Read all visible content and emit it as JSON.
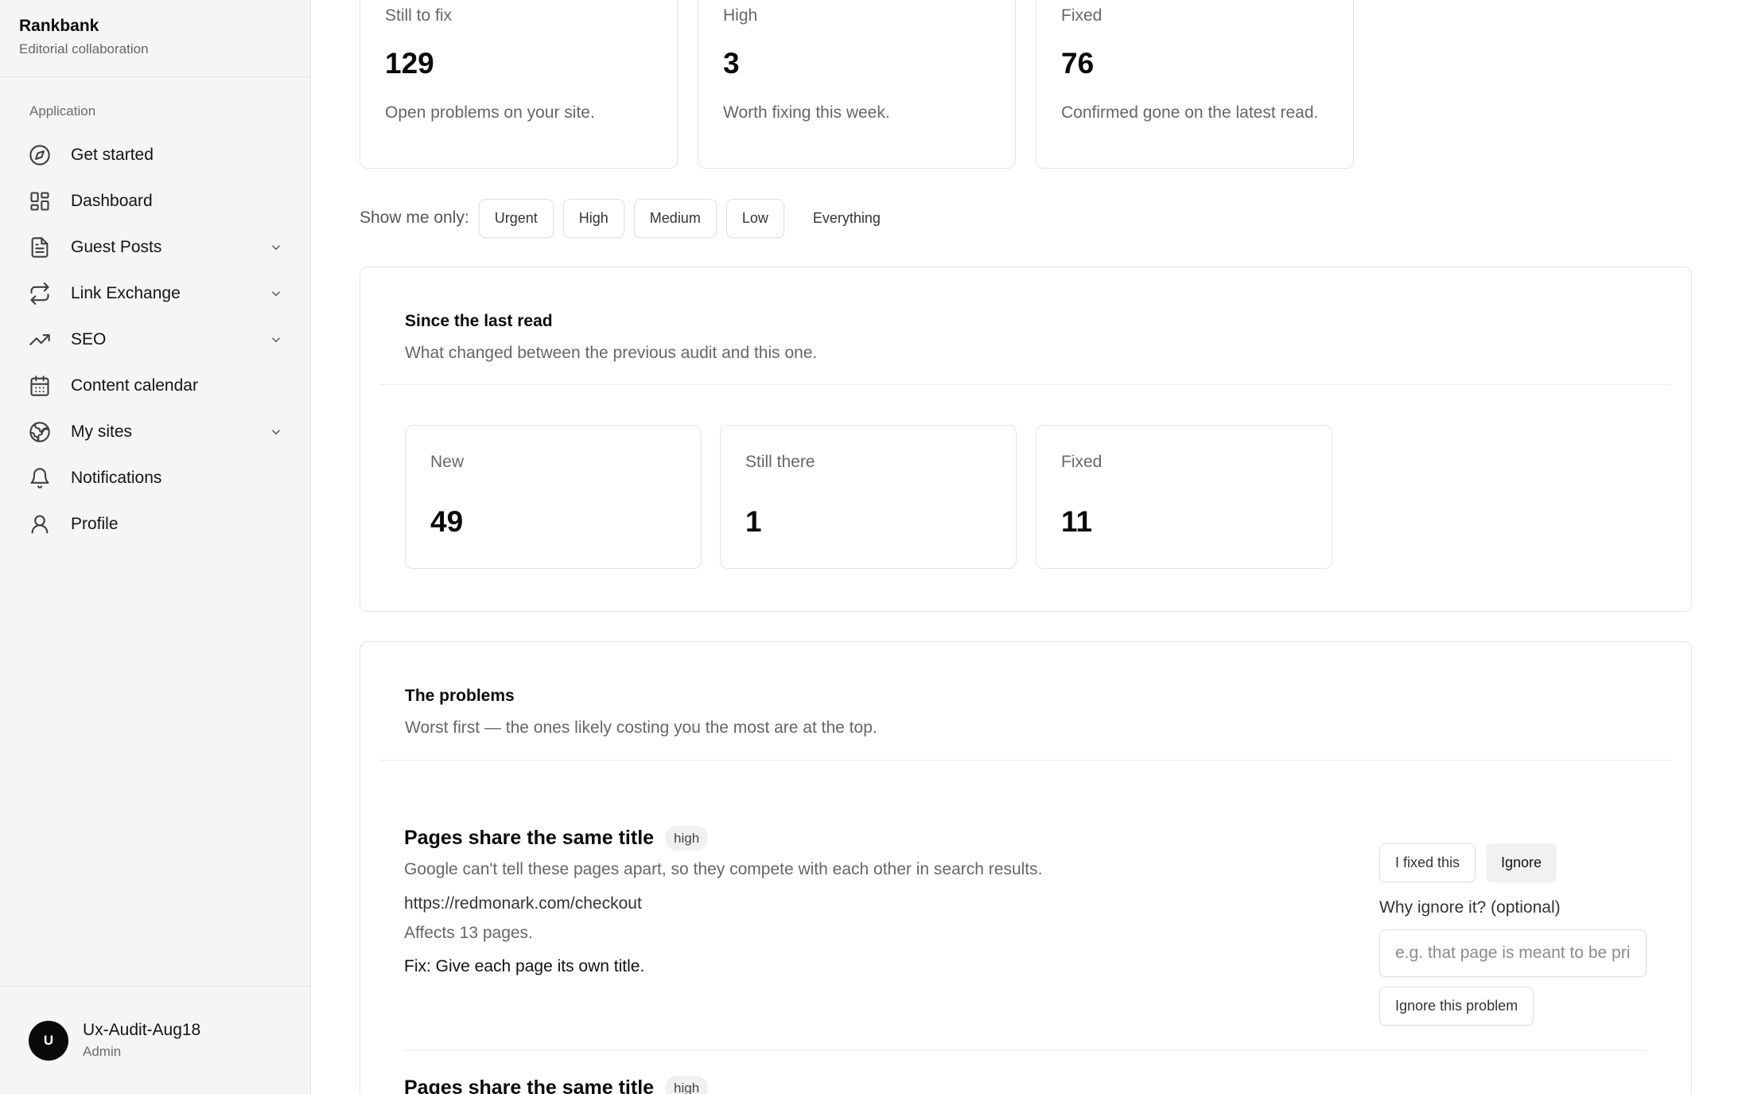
{
  "sidebar": {
    "brand_title": "Rankbank",
    "brand_subtitle": "Editorial collaboration",
    "group_label": "Application",
    "items": [
      {
        "label": "Get started",
        "icon": "compass-icon",
        "has_children": false
      },
      {
        "label": "Dashboard",
        "icon": "dashboard-icon",
        "has_children": false
      },
      {
        "label": "Guest Posts",
        "icon": "document-icon",
        "has_children": true
      },
      {
        "label": "Link Exchange",
        "icon": "repeat-icon",
        "has_children": true
      },
      {
        "label": "SEO",
        "icon": "trending-up-icon",
        "has_children": true
      },
      {
        "label": "Content calendar",
        "icon": "calendar-icon",
        "has_children": false
      },
      {
        "label": "My sites",
        "icon": "globe-icon",
        "has_children": true
      },
      {
        "label": "Notifications",
        "icon": "bell-icon",
        "has_children": false
      },
      {
        "label": "Profile",
        "icon": "user-icon",
        "has_children": false
      }
    ],
    "user": {
      "initial": "U",
      "name": "Ux-Audit-Aug18",
      "role": "Admin"
    }
  },
  "stats": [
    {
      "label": "Still to fix",
      "value": "129",
      "desc": "Open problems on your site."
    },
    {
      "label": "High",
      "value": "3",
      "desc": "Worth fixing this week."
    },
    {
      "label": "Fixed",
      "value": "76",
      "desc": "Confirmed gone on the latest read."
    }
  ],
  "filters": {
    "label": "Show me only:",
    "options": [
      "Urgent",
      "High",
      "Medium",
      "Low"
    ],
    "all_label": "Everything"
  },
  "since": {
    "title": "Since the last read",
    "subtitle": "What changed between the previous audit and this one.",
    "cards": [
      {
        "label": "New",
        "value": "49"
      },
      {
        "label": "Still there",
        "value": "1"
      },
      {
        "label": "Fixed",
        "value": "11"
      }
    ]
  },
  "problems": {
    "title": "The problems",
    "subtitle": "Worst first — the ones likely costing you the most are at the top.",
    "items": [
      {
        "title": "Pages share the same title",
        "severity": "high",
        "description": "Google can't tell these pages apart, so they compete with each other in search results.",
        "url": "https://redmonark.com/checkout",
        "affects": "Affects 13 pages.",
        "fix": "Fix: Give each page its own title.",
        "fixed_button": "I fixed this",
        "ignore_button": "Ignore",
        "why_label": "Why ignore it? (optional)",
        "why_placeholder": "e.g. that page is meant to be private",
        "ignore_problem_button": "Ignore this problem"
      },
      {
        "title": "Pages share the same title",
        "severity": "high"
      }
    ]
  },
  "colors": {
    "accent": "#0a0a0a",
    "muted": "#666666",
    "sidebar_bg": "#f5f5f5",
    "border": "#e3e3e3"
  }
}
